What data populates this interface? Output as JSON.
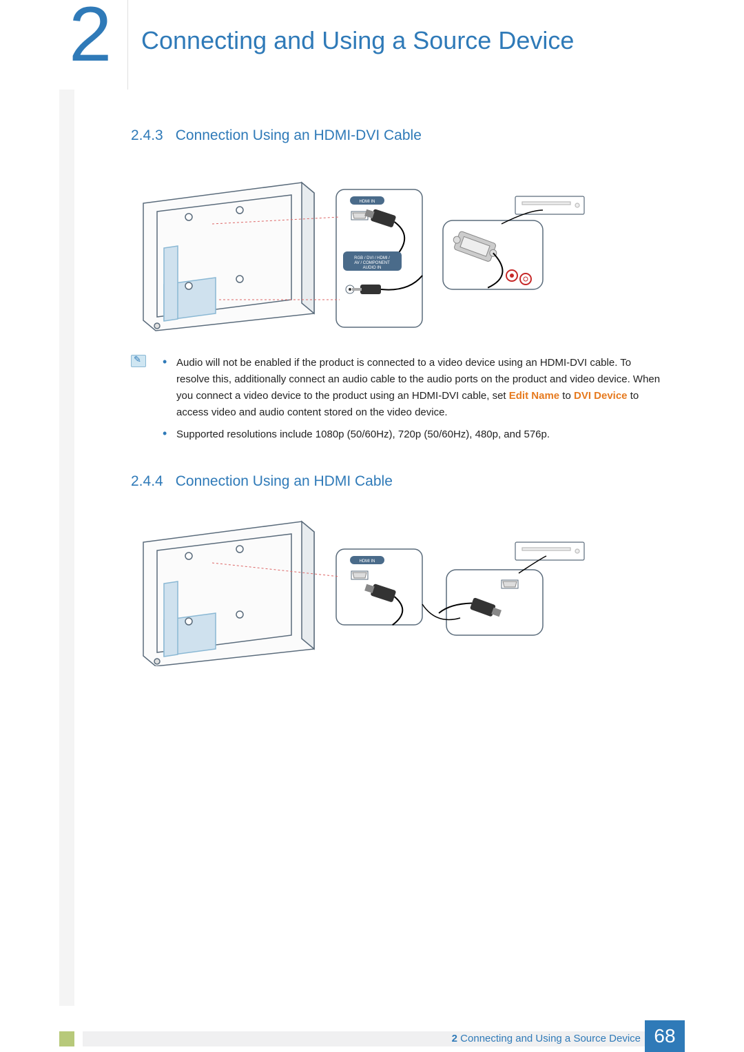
{
  "chapter": {
    "number": "2",
    "title": "Connecting and Using a Source Device"
  },
  "sections": [
    {
      "number": "2.4.3",
      "title": "Connection Using an HDMI-DVI Cable",
      "diagram": {
        "port_labels": [
          "HDMI IN",
          "RGB / DVI / HDMI / AV / COMPONENT AUDIO IN"
        ]
      },
      "note_bullets": [
        {
          "html": "Audio will not be enabled if the product is connected to a video device using an HDMI-DVI cable. To resolve this, additionally connect an audio cable to the audio ports on the product and video device. When you connect a video device to the product using an HDMI-DVI cable, set <span class='bold orange'>Edit Name</span> to <span class='bold orange'>DVI Device</span> to access video and audio content stored on the video device."
        },
        {
          "html": "Supported resolutions include 1080p (50/60Hz), 720p (50/60Hz), 480p, and 576p."
        }
      ]
    },
    {
      "number": "2.4.4",
      "title": "Connection Using an HDMI Cable",
      "diagram": {
        "port_labels": [
          "HDMI IN"
        ]
      }
    }
  ],
  "footer": {
    "chapter_ref": "2",
    "title": "Connecting and Using a Source Device",
    "page": "68"
  }
}
